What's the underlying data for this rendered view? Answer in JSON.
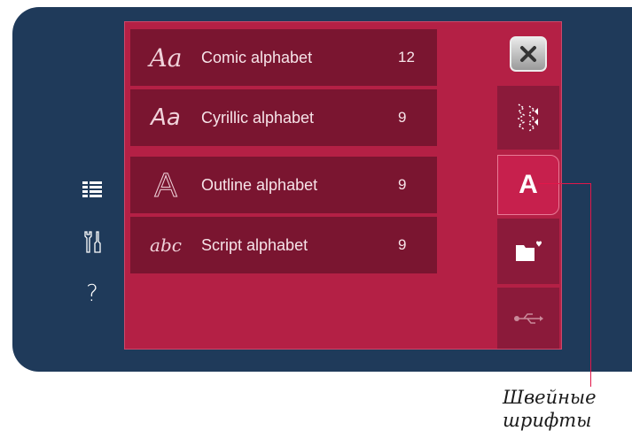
{
  "side_nav": {
    "help_label": "?"
  },
  "alphabets": [
    {
      "sample": "Aa",
      "label": "Comic alphabet",
      "count": "12"
    },
    {
      "sample": "Aa",
      "label": "Cyrillic alphabet",
      "count": "9"
    },
    {
      "sample": "A",
      "label": "Outline alphabet",
      "count": "9"
    },
    {
      "sample": "abc",
      "label": "Script alphabet",
      "count": "9"
    }
  ],
  "tabs": {
    "font_tab_label": "A"
  },
  "callout": {
    "line1": "Швейные",
    "line2": "шрифты"
  },
  "colors": {
    "frame": "#1f3a5a",
    "panel": "#b42045",
    "list_item": "#7a1530",
    "accent": "#e2174a"
  }
}
